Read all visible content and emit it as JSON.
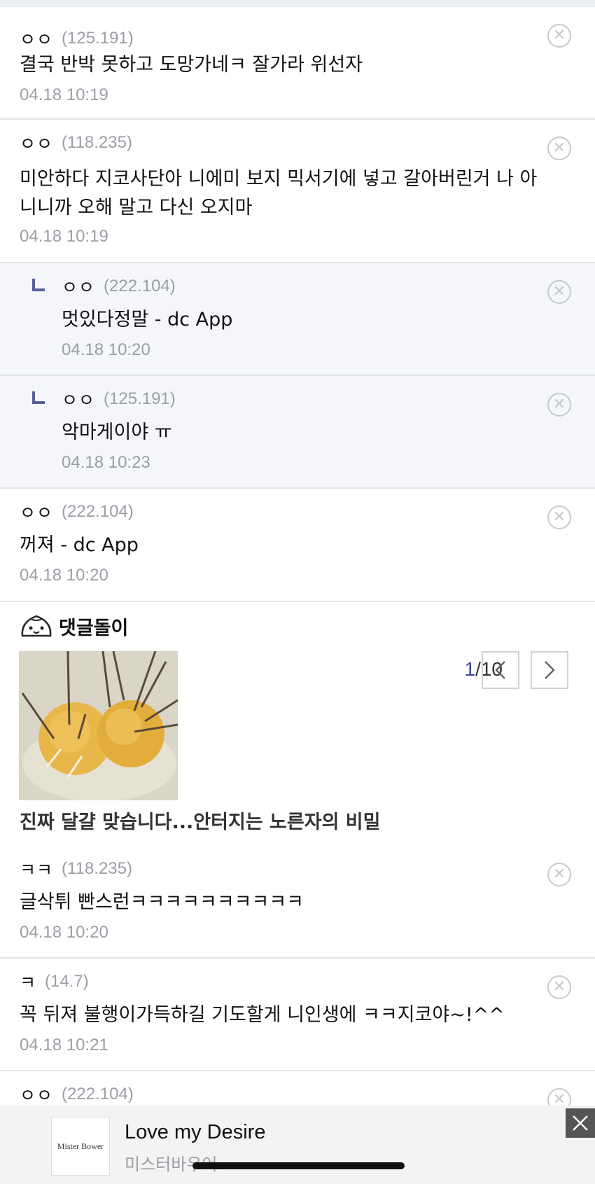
{
  "comments": [
    {
      "nick": "ㅇㅇ",
      "ip": "(125.191)",
      "text": "결국 반박 못하고 도망가네ㅋ 잘가라 위선자",
      "date": "04.18 10:19",
      "reply": false
    },
    {
      "nick": "ㅇㅇ",
      "ip": "(118.235)",
      "text": "미안하다 지코사단아 니에미 보지 믹서기에 넣고 갈아버린거 나 아니니까 오해 말고 다신 오지마",
      "date": "04.18 10:19",
      "reply": false
    },
    {
      "nick": "ㅇㅇ",
      "ip": "(222.104)",
      "text": "멋있다정말 - dc App",
      "date": "04.18 10:20",
      "reply": true
    },
    {
      "nick": "ㅇㅇ",
      "ip": "(125.191)",
      "text": "악마게이야 ㅠ",
      "date": "04.18 10:23",
      "reply": true
    },
    {
      "nick": "ㅇㅇ",
      "ip": "(222.104)",
      "text": "꺼져 - dc App",
      "date": "04.18 10:20",
      "reply": false
    }
  ],
  "bot": {
    "name": "댓글돌이",
    "page_current": "1",
    "page_total": "/10",
    "caption": "진짜 달걀 맞습니다...안터지는 노른자의 비밀"
  },
  "comments2": [
    {
      "nick": "ㅋㅋ",
      "ip": "(118.235)",
      "text": "글삭튀 빤스런ㅋㅋㅋㅋㅋㅋㅋㅋㅋㅋ",
      "date": "04.18 10:20",
      "reply": false
    },
    {
      "nick": "ㅋ",
      "ip": "(14.7)",
      "text": "꼭 뒤져 불행이가득하길 기도할게 니인생에 ㅋㅋ지코야~!^^",
      "date": "04.18 10:21",
      "reply": false
    },
    {
      "nick": "ㅇㅇ",
      "ip": "(222.104)"
    }
  ],
  "ad": {
    "logo_text": "Mister Bower",
    "title": "Love my Desire",
    "subtitle": "미스터바우어"
  },
  "icons": {
    "delete": "circle-x-icon",
    "reply": "reply-arrow-icon",
    "bot": "dumpling-mascot-icon",
    "prev": "chevron-left-icon",
    "next": "chevron-right-icon",
    "close": "close-icon"
  },
  "colors": {
    "accent": "#3b4890",
    "reply_bg": "#f4f6fa",
    "meta": "#9a9ea6"
  }
}
